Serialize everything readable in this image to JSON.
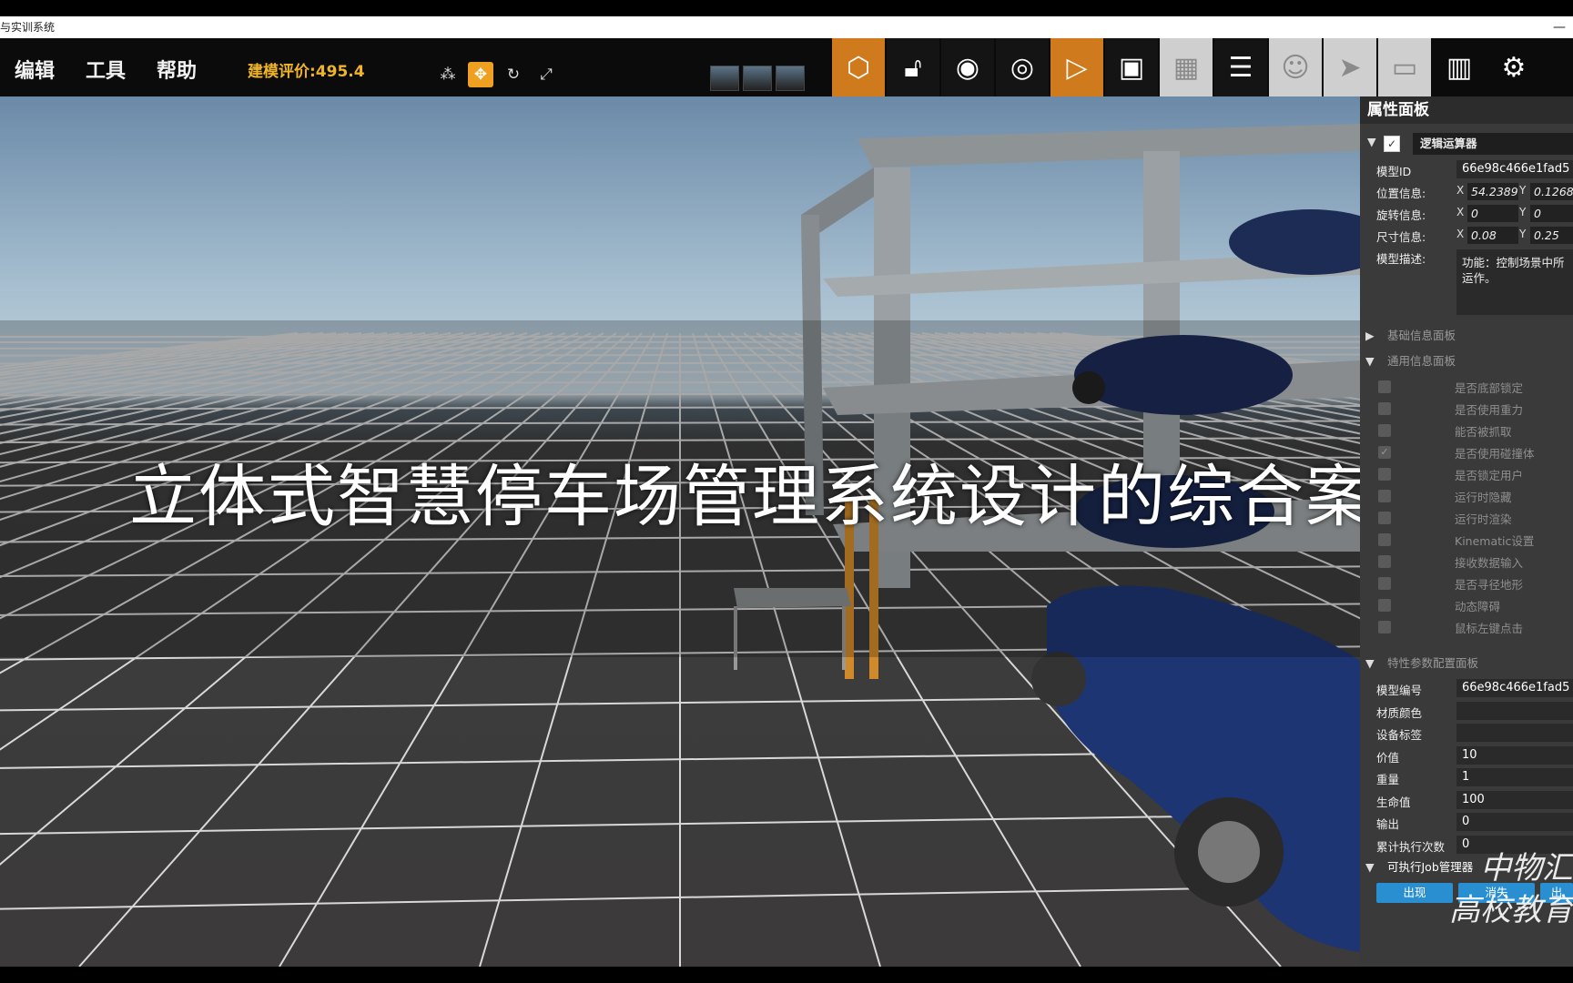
{
  "window": {
    "title": "与实训系统",
    "minimize": "—"
  },
  "menu": [
    {
      "label": "编辑"
    },
    {
      "label": "工具"
    },
    {
      "label": "帮助"
    }
  ],
  "score": "建模评价:495.4",
  "overlay_title": "立体式智慧停车场管理系统设计的综合案例",
  "panel": {
    "header": "属性面板",
    "logic_name": "逻辑运算器",
    "model_id_label": "模型ID",
    "model_id": "66e98c466e1fad5",
    "position_label": "位置信息:",
    "position": {
      "x": "54.2389",
      "y": "0.1268"
    },
    "rotation_label": "旋转信息:",
    "rotation": {
      "x": "0",
      "y": "0"
    },
    "size_label": "尺寸信息:",
    "size": {
      "x": "0.08",
      "y": "0.25"
    },
    "desc_label": "模型描述:",
    "desc": "功能：控制场景中所\n运作。",
    "basic_section": "基础信息面板",
    "general_section": "通用信息面板",
    "checkboxes": [
      "是否底部锁定",
      "是否使用重力",
      "能否被抓取",
      "是否使用碰撞体",
      "是否锁定用户",
      "运行时隐藏",
      "运行时渲染",
      "Kinematic设置",
      "接收数据输入",
      "是否寻径地形",
      "动态障碍",
      "鼠标左键点击"
    ],
    "checked_index": 3,
    "special_section": "特性参数配置面板",
    "params": [
      {
        "label": "模型编号",
        "value": "66e98c466e1fad5"
      },
      {
        "label": "材质颜色",
        "value": ""
      },
      {
        "label": "设备标签",
        "value": ""
      },
      {
        "label": "价值",
        "value": "10"
      },
      {
        "label": "重量",
        "value": "1"
      },
      {
        "label": "生命值",
        "value": "100"
      },
      {
        "label": "输出",
        "value": "0"
      },
      {
        "label": "累计执行次数",
        "value": "0"
      }
    ],
    "job_section": "可执行Job管理器",
    "job_buttons": [
      "出现",
      "消失",
      "出"
    ]
  },
  "watermark": {
    "line1": "中物汇",
    "line2": "高校教育"
  },
  "colors": {
    "accent": "#d07a1e",
    "score": "#f0b428",
    "panel_bg": "#3a3a3a",
    "blue": "#2a8fd0"
  }
}
